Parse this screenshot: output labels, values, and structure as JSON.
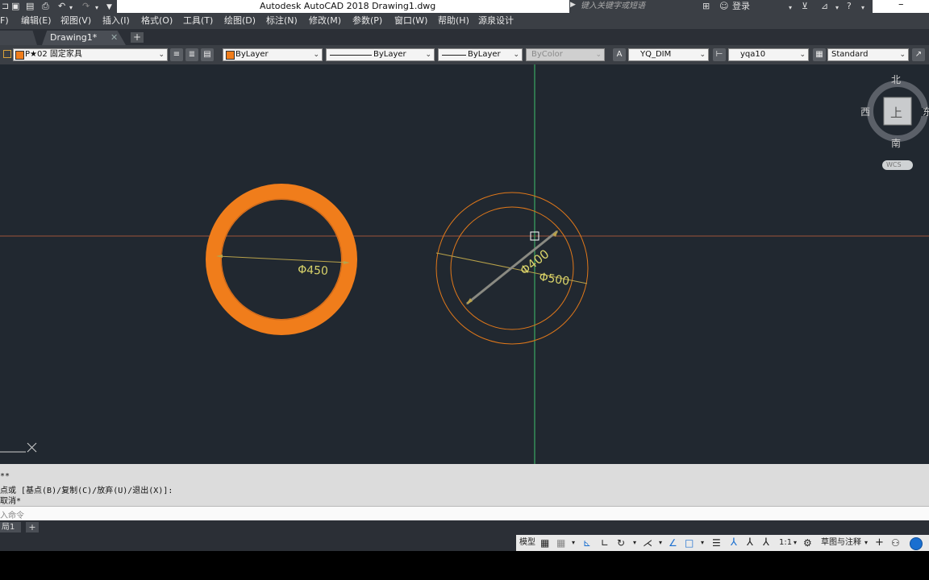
{
  "window": {
    "title": "Autodesk AutoCAD 2018    Drawing1.dwg"
  },
  "search": {
    "placeholder": "键入关键字或短语"
  },
  "user": {
    "login_label": "登录"
  },
  "menu": {
    "items": [
      "F)",
      "编辑(E)",
      "视图(V)",
      "插入(I)",
      "格式(O)",
      "工具(T)",
      "绘图(D)",
      "标注(N)",
      "修改(M)",
      "参数(P)",
      "窗口(W)",
      "帮助(H)",
      "源泉设计"
    ]
  },
  "tabs": {
    "active": "Drawing1*",
    "close": "✕",
    "add": "+"
  },
  "properties": {
    "layer": "P★02 固定家具",
    "color": "ByLayer",
    "linetype": "ByLayer",
    "lineweight": "ByLayer",
    "plotstyle": "ByColor",
    "dimstyle": "YQ_DIM",
    "multileader": "yqa10",
    "tablestyle": "Standard"
  },
  "viewcube": {
    "north": "北",
    "south": "南",
    "west": "西",
    "east": "东",
    "face": "上",
    "wcs": "WCS"
  },
  "drawing": {
    "dim_left": "Φ450",
    "dim_right_inner": "Φ400",
    "dim_right_outer": "Φ500",
    "colors": {
      "background": "#212830",
      "orange": "#f07d1b",
      "crosshair_green": "#3fc26b",
      "dim_yellow": "#d8d36a"
    }
  },
  "command": {
    "line1": "**",
    "line2": "点或 [基点(B)/复制(C)/放弃(U)/退出(X)]:",
    "line3": "取消*",
    "prompt": "入命令"
  },
  "layout": {
    "tab": "局1",
    "add": "+"
  },
  "status": {
    "model": "模型",
    "scale": "1:1",
    "workspace": "草图与注释"
  }
}
